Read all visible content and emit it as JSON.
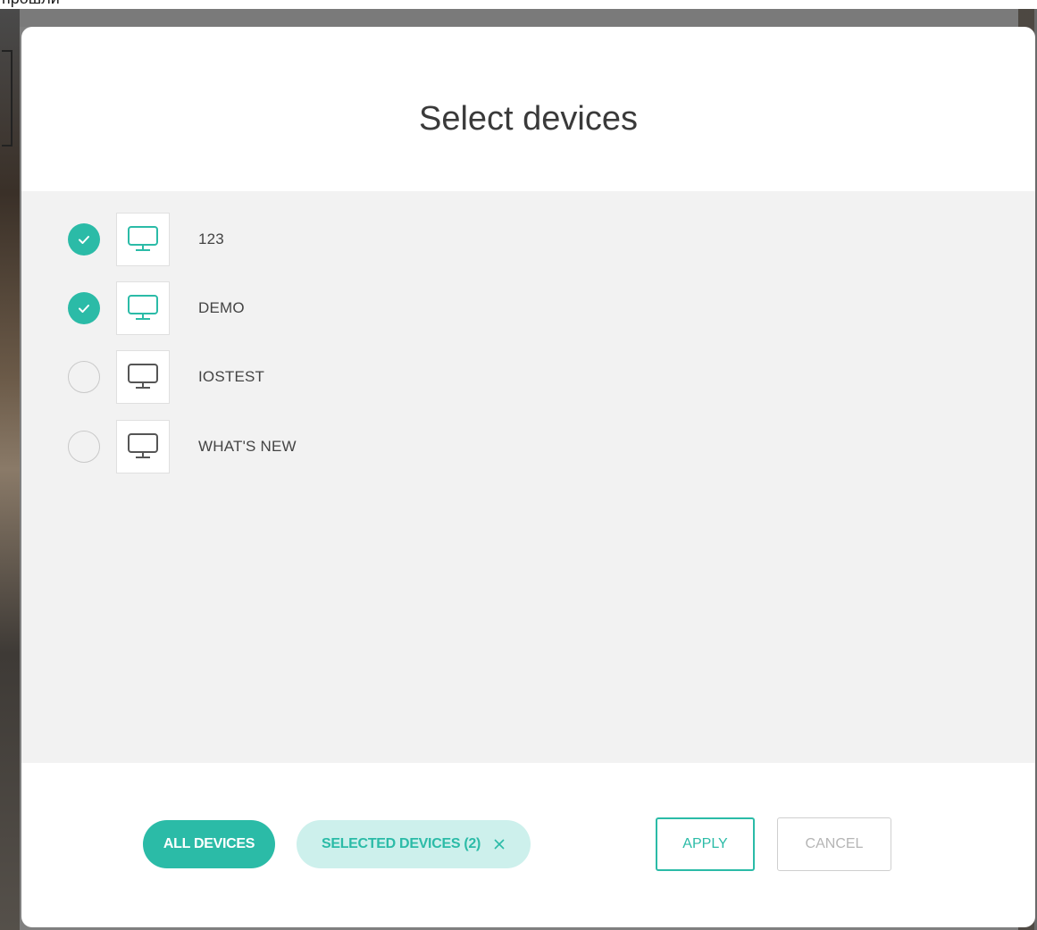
{
  "page": {
    "top_text": "прошли"
  },
  "dialog": {
    "title": "Select devices",
    "devices": [
      {
        "name": "123",
        "selected": true,
        "icon": "monitor-icon"
      },
      {
        "name": "DEMO",
        "selected": true,
        "icon": "monitor-icon"
      },
      {
        "name": "IOSTEST",
        "selected": false,
        "icon": "monitor-icon"
      },
      {
        "name": "WHAT'S NEW",
        "selected": false,
        "icon": "monitor-icon"
      }
    ],
    "filters": {
      "all_devices_label": "ALL DEVICES",
      "selected_devices_label": "SELECTED DEVICES (2)",
      "clear_icon": "close-icon"
    },
    "actions": {
      "apply_label": "APPLY",
      "cancel_label": "CANCEL"
    }
  },
  "colors": {
    "accent": "#2bbba7",
    "accent_light": "#cdf0ec",
    "list_background": "#f2f2f2",
    "icon_unselected": "#555555"
  }
}
